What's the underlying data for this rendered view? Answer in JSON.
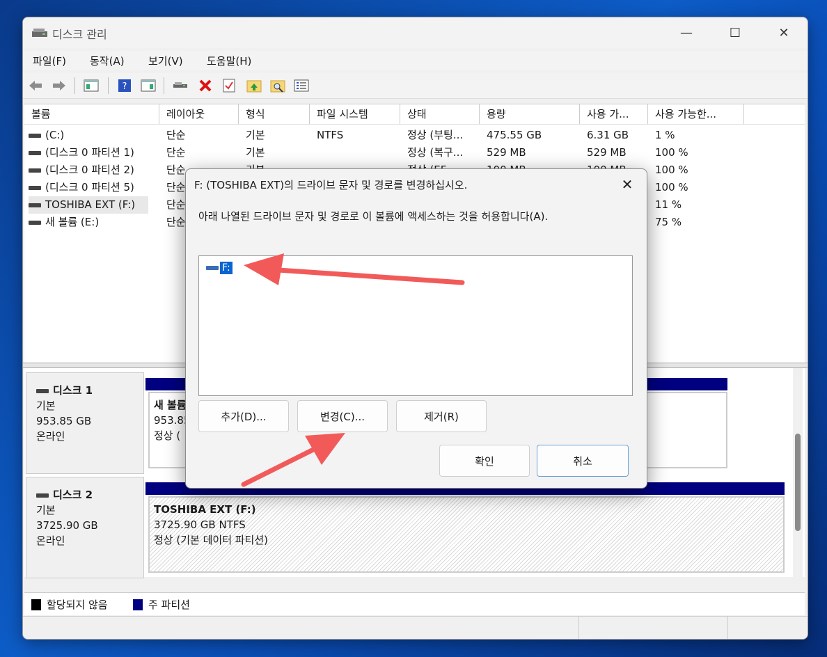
{
  "window": {
    "title": "디스크 관리",
    "minimize": "—",
    "maximize": "☐",
    "close": "✕"
  },
  "menu": [
    "파일(F)",
    "동작(A)",
    "보기(V)",
    "도움말(H)"
  ],
  "toolbar": {
    "icons": [
      "back-icon",
      "forward-icon",
      "console-tree-icon",
      "help-icon",
      "action-pane-icon",
      "connect-drive-icon",
      "delete-icon",
      "properties-icon",
      "folder-up-icon",
      "search-folder-icon",
      "list-view-icon"
    ]
  },
  "volume_table": {
    "columns": [
      "볼륨",
      "레이아웃",
      "형식",
      "파일 시스템",
      "상태",
      "용량",
      "사용 가...",
      "사용 가능한..."
    ],
    "rows": [
      [
        "(C:)",
        "단순",
        "기본",
        "NTFS",
        "정상 (부팅...",
        "475.55 GB",
        "6.31 GB",
        "1 %"
      ],
      [
        "(디스크 0 파티션 1)",
        "단순",
        "기본",
        "",
        "정상 (복구...",
        "529 MB",
        "529 MB",
        "100 %"
      ],
      [
        "(디스크 0 파티션 2)",
        "단순",
        "기본",
        "",
        "정상 (EF...",
        "100 MB",
        "100 MB",
        "100 %"
      ],
      [
        "(디스크 0 파티션 5)",
        "단순",
        "",
        "",
        "",
        "",
        "",
        "100 %"
      ],
      [
        "TOSHIBA EXT (F:)",
        "단순",
        "",
        "",
        "",
        "",
        "",
        "11 %"
      ],
      [
        "새 볼륨 (E:)",
        "단순",
        "",
        "",
        "",
        "",
        "",
        "75 %"
      ]
    ]
  },
  "disks": [
    {
      "name": "디스크 1",
      "type": "기본",
      "size": "953.85 GB",
      "status": "온라인",
      "partition": {
        "name": "새 볼륨",
        "size": "953.85",
        "status": "정상 ("
      }
    },
    {
      "name": "디스크 2",
      "type": "기본",
      "size": "3725.90 GB",
      "status": "온라인",
      "partition": {
        "name": "TOSHIBA EXT  (F:)",
        "size": "3725.90 GB NTFS",
        "status": "정상 (기본 데이터 파티션)"
      }
    }
  ],
  "legend": [
    {
      "label": "할당되지 않음",
      "color": "#000000"
    },
    {
      "label": "주 파티션",
      "color": "#000080"
    }
  ],
  "dialog": {
    "title": "F: (TOSHIBA EXT)의 드라이브 문자 및 경로를 변경하십시오.",
    "description": "아래 나열된 드라이브 문자 및 경로로 이 볼륨에 액세스하는 것을 허용합니다(A).",
    "items": [
      "F:"
    ],
    "buttons": {
      "add": "추가(D)...",
      "change": "변경(C)...",
      "remove": "제거(R)",
      "ok": "확인",
      "cancel": "취소"
    },
    "close": "✕"
  },
  "colors": {
    "accent": "#0a64d0",
    "partition_bar": "#000080",
    "annotation_arrow": "#f25a5a"
  }
}
